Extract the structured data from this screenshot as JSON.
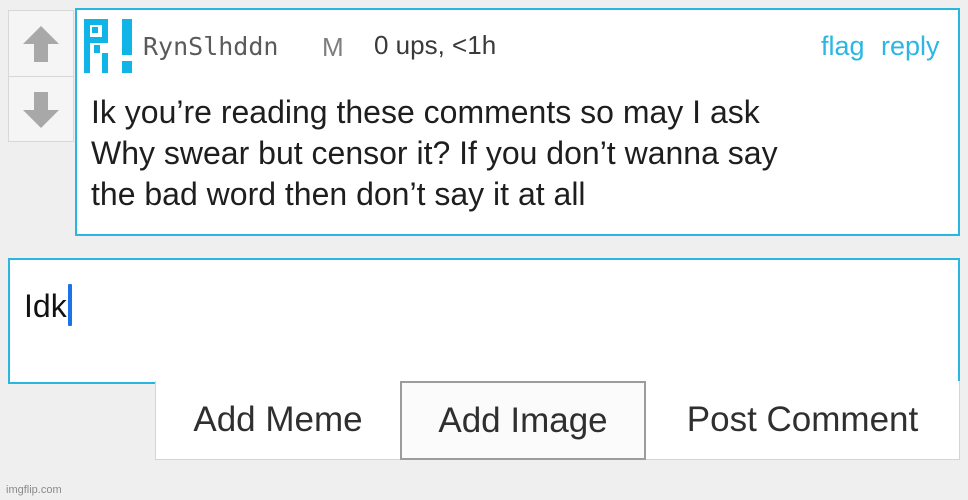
{
  "comment": {
    "username": "RynSlhddn",
    "gender": "M",
    "ups": "0 ups, <1h",
    "flag_label": "flag",
    "reply_label": "reply",
    "text": "Ik you’re reading these comments so may I ask\nWhy swear but censor it? If you don’t wanna say\nthe bad word then don’t say it at all",
    "avatar_color": "#10b4e6"
  },
  "vote": {
    "up_icon": "arrow-up-icon",
    "down_icon": "arrow-down-icon"
  },
  "reply_input": {
    "value": "Idk"
  },
  "buttons": {
    "add_meme": "Add Meme",
    "add_image": "Add Image",
    "post_comment": "Post Comment"
  },
  "watermark": "imgflip.com",
  "colors": {
    "accent": "#29b6e0",
    "caret": "#1a73e8"
  }
}
